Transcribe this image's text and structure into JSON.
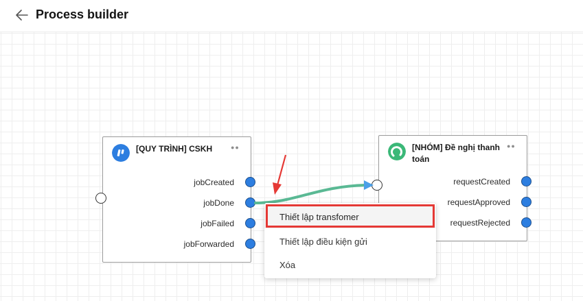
{
  "header": {
    "title": "Process builder",
    "back_icon": "arrow-left-icon"
  },
  "nodes": [
    {
      "title": "[QUY TRÌNH] CSKH",
      "logo_icon": "process-logo-icon",
      "logo_color": "#2d7ee0",
      "outputs": [
        "jobCreated",
        "jobDone",
        "jobFailed",
        "jobForwarded"
      ]
    },
    {
      "title_line1": "[NHÓM] Đề nghị thanh",
      "title_line2": "toán",
      "logo_icon": "group-logo-icon",
      "logo_color": "#3bb878",
      "outputs": [
        "requestCreated",
        "requestApproved",
        "requestRejected"
      ]
    }
  ],
  "connection": {
    "from": "jobDone",
    "color": "#5ab994",
    "arrow_color": "#4a9fe8"
  },
  "context_menu": {
    "items": [
      "Thiết lập transfomer",
      "Thiết lập điều kiện gửi",
      "Xóa"
    ],
    "highlighted": "Thiết lập transfomer"
  },
  "annotation": {
    "color": "#e53935"
  }
}
